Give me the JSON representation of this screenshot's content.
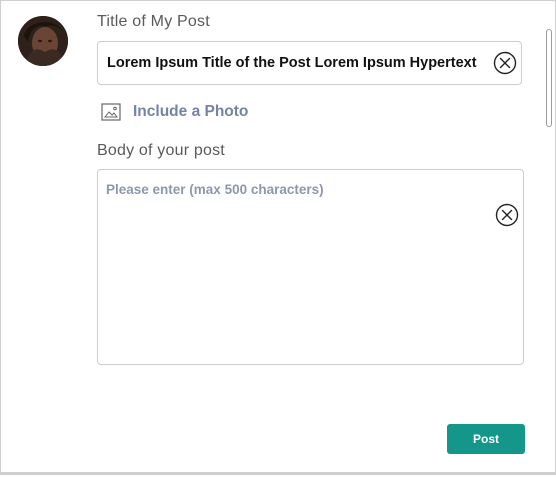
{
  "form": {
    "title_label": "Title of My Post",
    "title_value": "Lorem Ipsum Title of the Post Lorem Ipsum Hypertext",
    "photo_label": "Include a Photo",
    "body_label": "Body of your post",
    "body_placeholder": "Please enter (max 500 characters)",
    "post_label": "Post"
  },
  "icons": {
    "avatar": "user-avatar",
    "photo": "image-icon",
    "clear_title": "clear-circle-x-icon",
    "clear_body": "clear-circle-x-icon"
  },
  "colors": {
    "accent": "#14978a",
    "link": "#7483a6"
  }
}
